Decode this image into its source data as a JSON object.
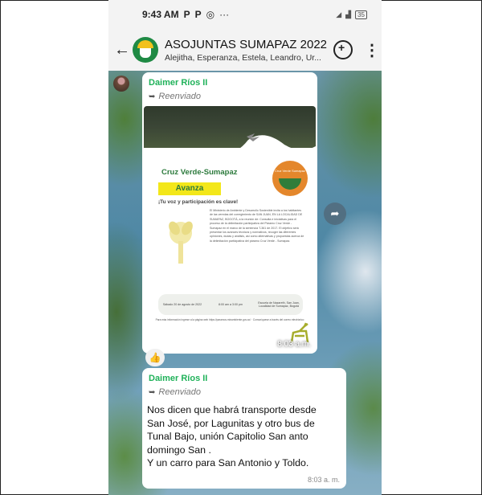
{
  "status_bar": {
    "time": "9:43 AM",
    "icons": [
      "P",
      "P",
      "◎",
      "···"
    ],
    "signal": "📶",
    "battery": "35"
  },
  "chat_header": {
    "title": "ASOJUNTAS SUMAPAZ 2022",
    "participants": "Alejitha, Esperanza, Estela, Leandro, Ur...",
    "back_glyph": "←",
    "more_glyph": "⋮"
  },
  "message_1": {
    "sender": "Daimer Ríos II",
    "forwarded_label": "Reenviado",
    "time": "8:03 a.m.",
    "poster": {
      "title": "Cruz Verde-Sumapaz",
      "highlight": "Avanza",
      "subtitle": "¡Tu voz y participación es clave!",
      "body": "El Ministerio de Ambiente y Desarrollo Sostenible invita a los habitantes de las veredas del corregimiento de SAN JUAN, EN LA LOCALIDAD DE SUMAPAZ, BOGOTÁ, a la reunión de: Consulta e iniciativas para el proceso de la delimitación participativa del Páramo Cruz Verde - Sumapaz en el marco de la sentencia T-361 de 2017. El objetivo será presentar los avances técnicos y normativos, recoger las diferentes opiniones, dudas y análisis, así como alternativas y propuestas acerca de la delimitación participativa del páramo Cruz Verde - Sumapaz.",
      "date": "Sábado 20 de agosto de 2022",
      "hours": "8:00 am a 3:00 pm",
      "place": "Escuela de Nazareth, San Juan, Localidad de Sumapaz, Bogotá",
      "footer": "Para más información ingrese a la página web https://paramos.minambiente.gov.co/ · Comuníquese a través del correo electrónico",
      "logo": "Cruz Verde Sumapaz"
    },
    "reaction": "👍",
    "share_glyph": "➦"
  },
  "message_2": {
    "sender": "Daimer Ríos II",
    "forwarded_label": "Reenviado",
    "text_lines": [
      "Nos dicen que habrá transporte desde",
      "San José, por Lagunitas y otro bus de",
      "Tunal Bajo, unión Capitolio San anto",
      "domingo San .",
      "Y un carro para San Antonio y Toldo."
    ],
    "time": "8:03 a. m."
  }
}
